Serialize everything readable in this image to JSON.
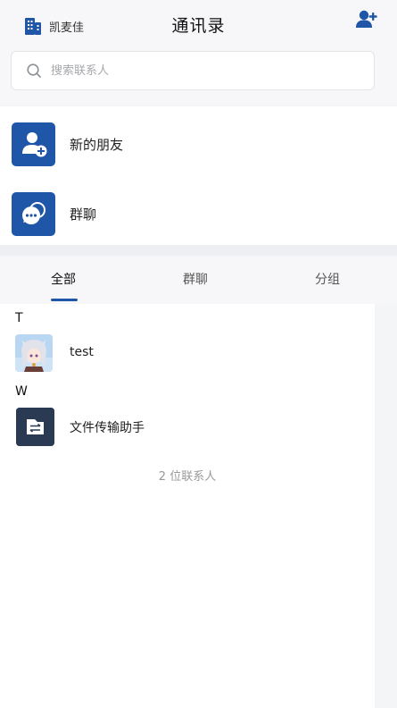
{
  "header": {
    "org_name": "凯麦佳",
    "title": "通讯录"
  },
  "search": {
    "placeholder": "搜索联系人"
  },
  "quick_entries": [
    {
      "label": "新的朋友",
      "icon": "user-plus-icon"
    },
    {
      "label": "群聊",
      "icon": "chat-bubbles-icon"
    }
  ],
  "tabs": [
    {
      "label": "全部",
      "active": true
    },
    {
      "label": "群聊",
      "active": false
    },
    {
      "label": "分组",
      "active": false
    }
  ],
  "contacts": {
    "groups": [
      {
        "letter": "T",
        "items": [
          {
            "name": "test",
            "avatar": "anime-character-avatar"
          }
        ]
      },
      {
        "letter": "W",
        "items": [
          {
            "name": "文件传输助手",
            "avatar": "file-transfer-icon"
          }
        ]
      }
    ],
    "count_text": "2 位联系人"
  },
  "colors": {
    "accent": "#1f56a7",
    "background": "#f4f5f7"
  }
}
